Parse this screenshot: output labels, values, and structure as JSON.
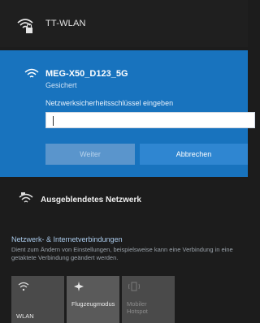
{
  "top_network": {
    "name": "TT-WLAN",
    "icon": "wifi-secured-icon"
  },
  "selected_network": {
    "ssid": "MEG-X50_D123_5G",
    "status": "Gesichert",
    "key_label": "Netzwerksicherheitsschlüssel eingeben",
    "key_value": "",
    "next_label": "Weiter",
    "cancel_label": "Abbrechen",
    "accent": "#1873be"
  },
  "hidden_network": {
    "label": "Ausgeblendetes Netzwerk",
    "icon": "wifi-hidden-icon"
  },
  "settings": {
    "title": "Netzwerk- & Internetverbindungen",
    "description": "Dient zum Ändern von Einstellungen, beispielsweise kann eine Verbindung in eine getaktete Verbindung geändert werden."
  },
  "quick_actions": [
    {
      "label": "WLAN",
      "icon": "wifi-icon"
    },
    {
      "label": "Flugzeugmodus",
      "icon": "airplane-icon"
    },
    {
      "label": "Mobiler Hotspot",
      "icon": "hotspot-icon"
    }
  ]
}
